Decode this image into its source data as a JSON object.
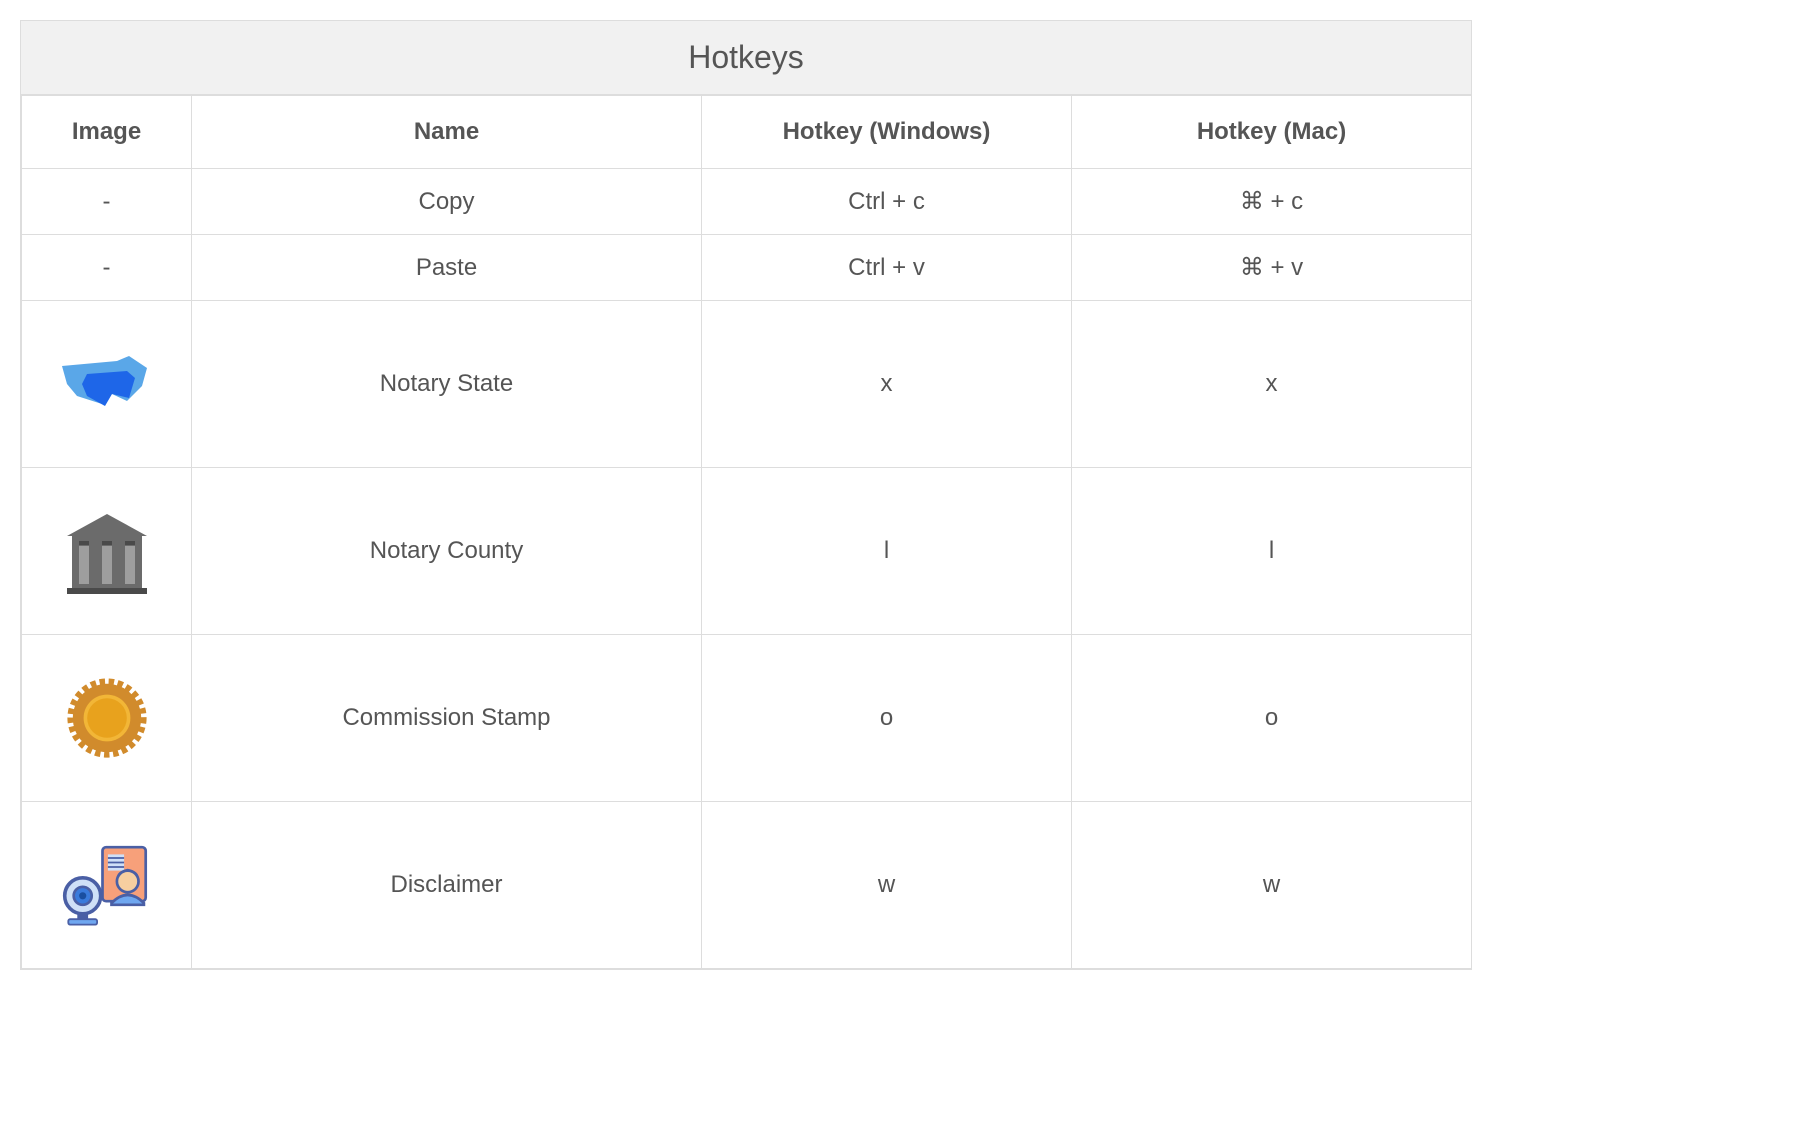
{
  "title": "Hotkeys",
  "columns": {
    "image": "Image",
    "name": "Name",
    "win": "Hotkey (Windows)",
    "mac": "Hotkey (Mac)"
  },
  "rows": [
    {
      "icon": "none",
      "image_label": "-",
      "name": "Copy",
      "win": "Ctrl + c",
      "mac": "⌘ + c"
    },
    {
      "icon": "none",
      "image_label": "-",
      "name": "Paste",
      "win": "Ctrl + v",
      "mac": "⌘ + v"
    },
    {
      "icon": "state-map-icon",
      "image_label": "",
      "name": "Notary State",
      "win": "x",
      "mac": "x"
    },
    {
      "icon": "county-building-icon",
      "image_label": "",
      "name": "Notary County",
      "win": "l",
      "mac": "l"
    },
    {
      "icon": "commission-stamp-icon",
      "image_label": "",
      "name": "Commission Stamp",
      "win": "o",
      "mac": "o"
    },
    {
      "icon": "disclaimer-icon",
      "image_label": "",
      "name": "Disclaimer",
      "win": "w",
      "mac": "w"
    }
  ]
}
